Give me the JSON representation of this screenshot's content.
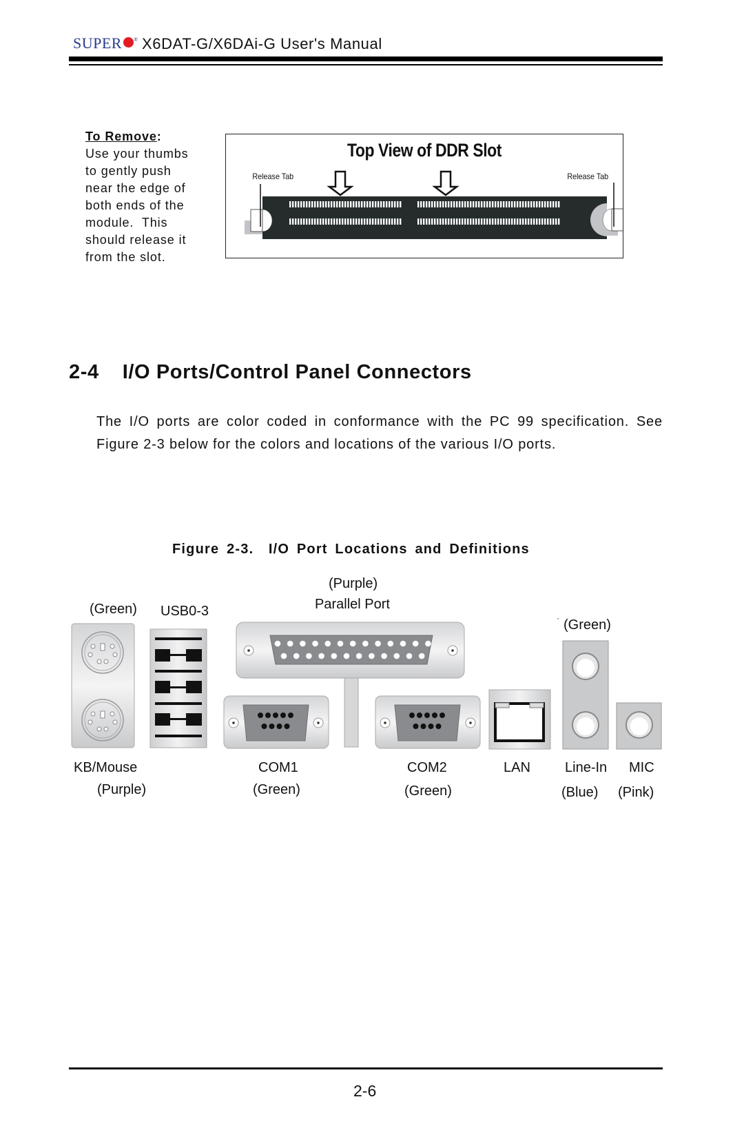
{
  "header": {
    "brand": "SUPER",
    "brand_mark": "®",
    "title": "X6DAT-G/X6DAi-G User's Manual"
  },
  "remove_note": {
    "heading": "To Remove",
    "heading_colon": ":",
    "lines": [
      "Use your thumbs",
      "to gently push",
      "near the edge of",
      "both ends of the",
      "module.  This",
      "should release it",
      "from the slot."
    ]
  },
  "ddr_figure": {
    "title": "Top View of DDR Slot",
    "left_label": "Release Tab",
    "right_label": "Release Tab"
  },
  "section": {
    "number": "2-4",
    "title": "I/O Ports/Control Panel Connectors",
    "paragraph": "The I/O ports are color coded in conformance with the PC 99 specification. See Figure 2-3 below for the colors and locations of the various I/O ports."
  },
  "io_figure": {
    "caption": "Figure 2-3.  I/O Port Locations and Definitions",
    "labels": {
      "kb_color_top": "(Green)",
      "usb": "USB0-3",
      "parallel_color": "(Purple)",
      "parallel": "Parallel Port",
      "lineout_mark": "·",
      "lineout_color": "(Green)",
      "kb_mouse": "KB/Mouse",
      "kb_color_bottom": "(Purple)",
      "com1": "COM1",
      "com1_color": "(Green)",
      "com2": "COM2",
      "com2_color": "(Green)",
      "lan": "LAN",
      "line_in": "Line-In",
      "line_in_color": "(Blue)",
      "mic": "MIC",
      "mic_color": "(Pink)"
    }
  },
  "footer": {
    "page_number": "2-6"
  }
}
